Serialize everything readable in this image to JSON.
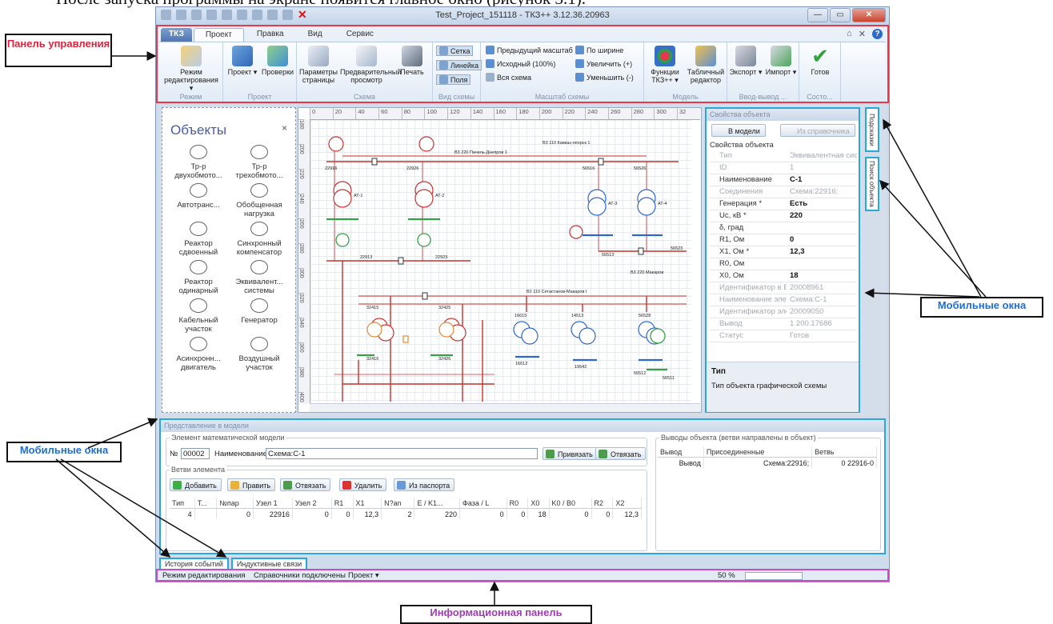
{
  "caption": "После запуска программы на экране появится главное окно (рисунок 3.1).",
  "window": {
    "title": "Test_Project_151118 - ТКЗ++ 3.12.36.20963",
    "quick_access_close": "✕",
    "min_label": "—",
    "max_label": "▭",
    "close_label": "✕"
  },
  "ribbon": {
    "app_tab": "ТКЗ",
    "tabs": [
      "Проект",
      "Правка",
      "Вид",
      "Сервис"
    ],
    "active_tab": "Проект",
    "right_icons": [
      "⌂",
      "✕",
      "?"
    ],
    "groups": {
      "mode": {
        "label": "Режим",
        "btn": "Режим редактирования ▾"
      },
      "project": {
        "label": "Проект",
        "btn1": "Проект ▾",
        "btn2": "Проверки"
      },
      "scheme": {
        "label": "Схема",
        "btn1": "Параметры страницы",
        "btn2": "Предварительный просмотр",
        "btn3": "Печать"
      },
      "view": {
        "label": "Вид схемы",
        "items": [
          "Сетка",
          "Линейка",
          "Поля"
        ]
      },
      "scale": {
        "label": "Масштаб схемы",
        "items": [
          "Предыдущий масштаб",
          "Исходный (100%)",
          "Вся схема",
          "По ширине",
          "Увеличить (+)",
          "Уменьшить (-)"
        ]
      },
      "model": {
        "label": "Модель",
        "btn1": "Функции ТКЗ++ ▾",
        "btn2": "Табличный редактор"
      },
      "io": {
        "label": "Ввод-вывод ...",
        "btn1": "Экспорт ▾",
        "btn2": "Импорт ▾"
      },
      "state": {
        "label": "Состо...",
        "btn": "Готов"
      }
    }
  },
  "objects_panel": {
    "title": "Объекты",
    "close": "×",
    "items": [
      "Тр-р двухобмото...",
      "Тр-р трехобмото...",
      "Автотранс...",
      "Обобщенная нагрузка",
      "Реактор сдвоенный",
      "Синхронный компенсатор",
      "Реактор одинарный",
      "Эквивалент... системы",
      "Кабельный участок",
      "Генератор",
      "Асинхронн... двигатель",
      "Воздушный участок"
    ]
  },
  "ruler": {
    "h": [
      "0",
      "20",
      "40",
      "60",
      "80",
      "100",
      "120",
      "140",
      "160",
      "180",
      "200",
      "220",
      "240",
      "260",
      "280",
      "300",
      "32"
    ],
    "v": [
      "180",
      "200",
      "220",
      "240",
      "260",
      "280",
      "300",
      "320",
      "340",
      "360",
      "380",
      "400"
    ]
  },
  "scheme_labels": {
    "n1": "22916",
    "n2": "22926",
    "n3": "56516",
    "n4": "56526",
    "b1": "В3 220 Пачель-Днепров 1",
    "b2": "В3 110 Кавказ-нпорск 1",
    "n5": "22913",
    "n6": "22923",
    "n7": "56513",
    "n8": "56523",
    "l1": "В2 110 Сетастанов-Макаров I",
    "l2": "В3 220 Макаров",
    "n9": "32415",
    "n10": "32425",
    "n11": "16615",
    "n12": "14513",
    "n13": "56528",
    "n14": "32416",
    "n15": "32426",
    "n16": "16612",
    "n17": "19542",
    "n18": "56512",
    "n19": "56511",
    "t1": "АТ-1",
    "t2": "АТ-2",
    "t3": "АТ-3",
    "t4": "АТ-4"
  },
  "properties": {
    "title": "Свойства объекта",
    "btn_model": "В модели",
    "btn_ref": "Из справочника",
    "section": "Свойства объекта",
    "rows": [
      {
        "k": "Тип",
        "v": "Эквивалентная сис...",
        "dim": true
      },
      {
        "k": "ID",
        "v": "1",
        "dim": true
      },
      {
        "k": "Наименование",
        "v": "С-1",
        "dim": false
      },
      {
        "k": "Соединения",
        "v": "Схема:22916;",
        "dim": true
      },
      {
        "k": "Генерация *",
        "v": "Есть",
        "dim": false
      },
      {
        "k": "Uс, кВ *",
        "v": "220",
        "dim": false
      },
      {
        "k": "δ, град",
        "v": "",
        "dim": false
      },
      {
        "k": "R1, Ом",
        "v": "0",
        "dim": false
      },
      {
        "k": "X1, Ом *",
        "v": "12,3",
        "dim": false
      },
      {
        "k": "R0, Ом",
        "v": "",
        "dim": false
      },
      {
        "k": "X0, Ом",
        "v": "18",
        "dim": false
      },
      {
        "k": "Идентификатор в Б",
        "v": "20008961",
        "dim": true
      },
      {
        "k": "Наименование элем",
        "v": "Схема:С-1",
        "dim": true
      },
      {
        "k": "Идентификатор эле",
        "v": "20009050",
        "dim": true
      },
      {
        "k": "Вывод",
        "v": "1 200.17686",
        "dim": true
      },
      {
        "k": "Статус",
        "v": "Готов",
        "dim": true
      }
    ],
    "desc_title": "Тип",
    "desc_text": "Тип объекта графической схемы"
  },
  "side_tabs": [
    "Подсказки",
    "Поиск объекта"
  ],
  "model_view": {
    "title": "Представление в модели",
    "element_group": "Элемент математической модели",
    "no_label": "№",
    "no_value": "00002",
    "name_label": "Наименование",
    "name_value": "Схема:С-1",
    "bind_btn": "Привязать",
    "unbind_btn": "Отвязать",
    "branches_group": "Ветви элемента",
    "branch_btns": [
      "Добавить",
      "Править",
      "Отвязать",
      "Удалить",
      "Из паспорта"
    ],
    "table_headers": [
      "Тип",
      "Т...",
      "№пар",
      "Узел 1",
      "Узел 2",
      "R1",
      "X1",
      "N?an",
      "E / K1...",
      "Фаза / L",
      "R0",
      "X0",
      "K0 / B0",
      "R2",
      "X2"
    ],
    "table_row": [
      "4",
      "",
      "0",
      "22916",
      "0",
      "0",
      "12,3",
      "2",
      "220",
      "0",
      "0",
      "18",
      "0",
      "0",
      "12,3"
    ],
    "outputs_group": "Выводы объекта (ветви направлены в объект)",
    "outputs_headers": [
      "Вывод",
      "Присоединенные",
      "Ветвь"
    ],
    "outputs_row": [
      "Вывод",
      "Схема:22916;",
      "0 22916-0"
    ]
  },
  "doc_tabs": [
    "История событий",
    "Индуктивные связи"
  ],
  "status": {
    "mode": "Режим редактирования",
    "refs": "Справочники подключены",
    "project": "Проект ▾",
    "zoom": "50 %"
  },
  "callouts": {
    "ribbon": "Панель управления",
    "mobile_left": "Мобильные окна",
    "mobile_right": "Мобильные окна",
    "info": "Информационная панель"
  },
  "colors": {
    "ribbon_border": "#e8384a",
    "mobile_border": "#2aa6d8",
    "info_border": "#c64cc8",
    "callout_red": "#e0203a",
    "callout_blue": "#1f6fd1",
    "callout_purple": "#a23ab8"
  }
}
